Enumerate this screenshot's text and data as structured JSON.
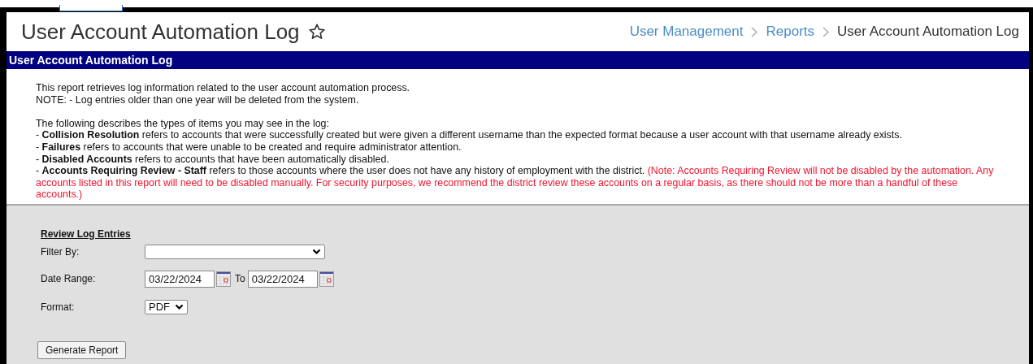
{
  "header": {
    "title": "User Account Automation Log",
    "favorite": false,
    "breadcrumbs": [
      {
        "label": "User Management",
        "link": true
      },
      {
        "label": "Reports",
        "link": true
      },
      {
        "label": "User Account Automation Log",
        "link": false
      }
    ]
  },
  "section_bar": {
    "title": "User Account Automation Log"
  },
  "description": {
    "intro": [
      "This report retrieves log information related to the user account automation process.",
      "NOTE: - Log entries older than one year will be deleted from the system."
    ],
    "types_heading": "The following describes the types of items you may see in the log:",
    "types": [
      {
        "text": "- **Collision Resolution** refers to accounts that were successfully created but were given a different username than the expected format because a user account with that username already exists."
      },
      {
        "text": "- **Failures** refers to accounts that were unable to be created and require administrator attention."
      },
      {
        "text": "- **Disabled Accounts** refers to accounts that have been automatically disabled."
      },
      {
        "text": "- **Accounts Requiring Review - Staff** refers to those accounts where the user does not have any history of employment with the district.",
        "note": "(Note: Accounts Requiring Review will not be disabled by the automation. Any accounts listed in this report will need to be disabled manually. For security purposes, we recommend the district review these accounts on a regular basis, as there should not be more than a handful of these accounts.)"
      }
    ]
  },
  "form": {
    "heading": "Review Log Entries",
    "fields": [
      {
        "kind": "select",
        "label": "Filter By:"
      },
      {
        "kind": "daterange",
        "label": "Date Range:",
        "from": "03/22/2024",
        "separator": "To",
        "to": "03/22/2024"
      },
      {
        "kind": "select",
        "label": "Format:",
        "value": "PDF"
      }
    ],
    "button": "Generate Report"
  }
}
